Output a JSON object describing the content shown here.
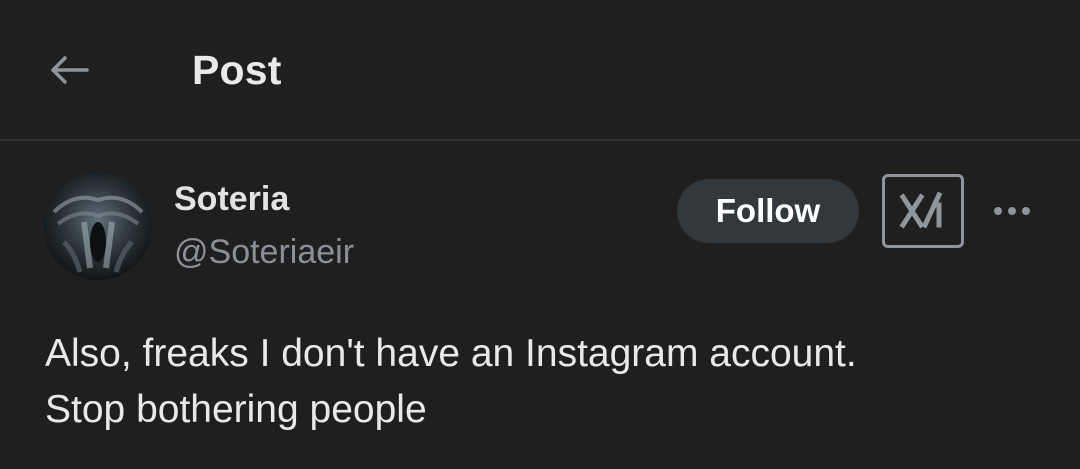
{
  "header": {
    "back_icon": "arrow-left-icon",
    "title": "Post"
  },
  "post": {
    "author": {
      "display_name": "Soteria",
      "handle": "@Soteriaeir"
    },
    "follow_label": "Follow",
    "grok_icon": "grok-logo-icon",
    "more_icon": "ellipsis-horizontal-icon",
    "text_lines": [
      "Also, freaks I don't have an Instagram account.",
      "Stop bothering people"
    ]
  },
  "colors": {
    "background": "#1f1f1f",
    "divider": "#2f3336",
    "text_primary": "#e7e9ea",
    "text_secondary": "#8b9096",
    "follow_button_bg": "#33383c"
  }
}
